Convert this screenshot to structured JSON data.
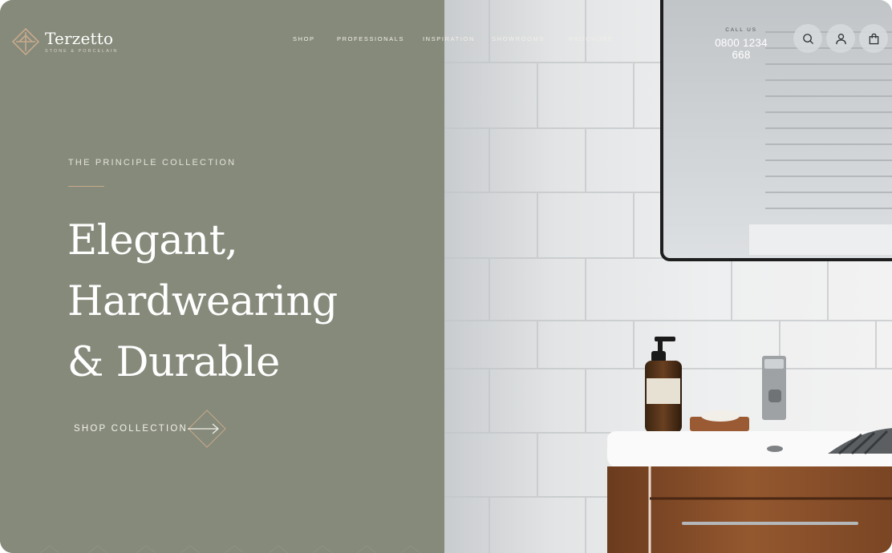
{
  "brand": {
    "name": "Terzetto",
    "tagline": "STONE & PORCELAIN"
  },
  "nav": {
    "items": [
      "SHOP",
      "PROFESSIONALS",
      "INSPIRATION",
      "SHOWROOMS",
      "BROCHURE"
    ]
  },
  "contact": {
    "label": "CALL US",
    "phone": "0800 1234 668"
  },
  "header_icons": [
    "search-icon",
    "account-icon",
    "bag-icon"
  ],
  "hero": {
    "eyebrow": "THE PRINCIPLE COLLECTION",
    "headline": [
      "Elegant,",
      "Hardwearing",
      "& Durable"
    ],
    "cta_label": "SHOP COLLECTION"
  },
  "colors": {
    "panel": "#858a7a",
    "accent": "#c8a98c",
    "text": "#ffffff"
  }
}
